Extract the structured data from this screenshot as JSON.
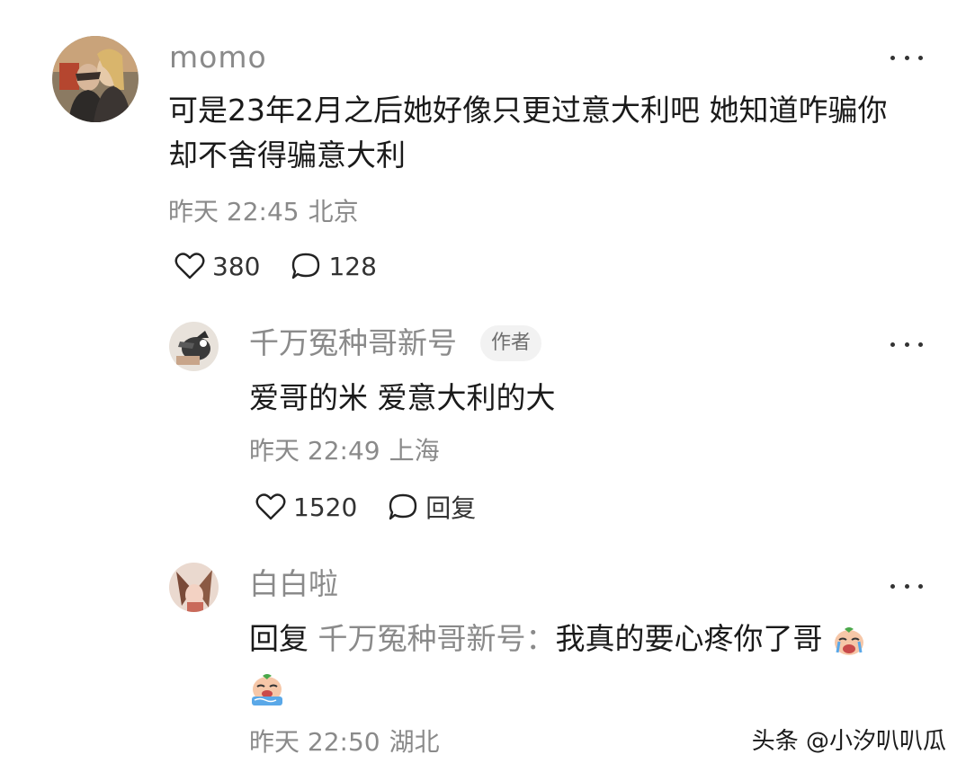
{
  "comments": [
    {
      "username": "momo",
      "text_line1": "可是23年2月之后她好像只更过意大利吧 她知道咋骗你",
      "text_line2": "却不舍得骗意大利",
      "time": "昨天 22:45",
      "location": "北京",
      "likes": "380",
      "replies": "128"
    },
    {
      "username": "千万冤种哥新号",
      "badge": "作者",
      "text": "爱哥的米 爱意大利的大",
      "time": "昨天 22:49",
      "location": "上海",
      "likes": "1520",
      "reply_label": "回复"
    },
    {
      "username": "白白啦",
      "reply_prefix": "回复",
      "reply_target": "千万冤种哥新号：",
      "text": "我真的要心疼你了哥",
      "time": "昨天 22:50",
      "location": "湖北"
    }
  ],
  "watermark": "头条 @小汐叭叭瓜",
  "icons": {
    "like": "heart-outline-icon",
    "comment": "speech-bubble-icon",
    "more": "more-dots-icon",
    "emoji": "crying-emoji-icon"
  }
}
